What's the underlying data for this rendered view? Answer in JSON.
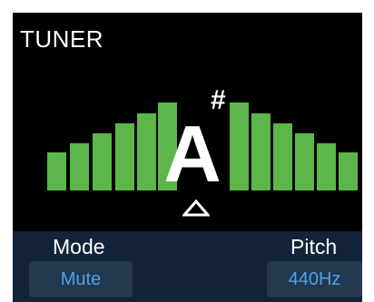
{
  "title": "TUNER",
  "note": {
    "letter": "A",
    "accidental": "#",
    "deviation_indicator": "triangle-up-icon"
  },
  "meter": {
    "left_segments_lit": 6,
    "right_segments_lit": 6,
    "lit_color": "#5cb64a"
  },
  "controls": {
    "mode": {
      "label": "Mode",
      "value": "Mute"
    },
    "pitch": {
      "label": "Pitch",
      "value": "440Hz"
    }
  },
  "colors": {
    "screen_background": "#000000",
    "panel_background": "#13233a",
    "button_background": "#24384f",
    "button_text": "#4aa3ea",
    "text": "#ffffff"
  }
}
